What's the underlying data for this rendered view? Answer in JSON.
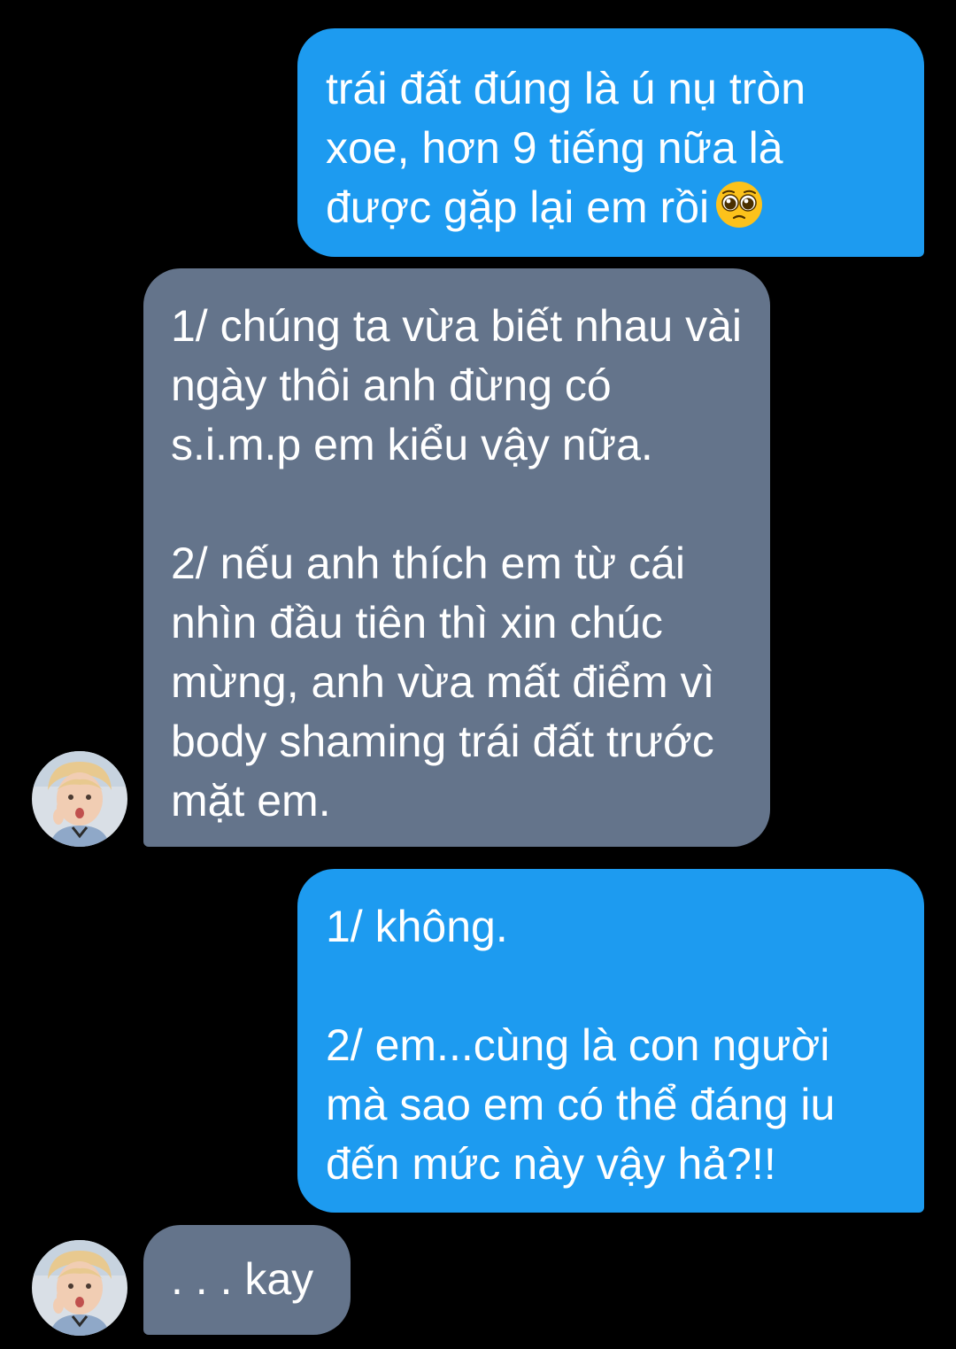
{
  "messages": [
    {
      "sender": "me",
      "text": "trái đất đúng là ú nụ tròn xoe, hơn 9 tiếng nữa là được gặp lại em rồi",
      "emoji": "pleading-face-icon"
    },
    {
      "sender": "them",
      "text": "1/ chúng ta vừa biết nhau vài ngày thôi anh đừng có s.i.m.p em kiểu vậy nữa.\n\n2/ nếu anh thích em từ cái nhìn đầu tiên thì xin chúc mừng, anh vừa mất điểm vì body shaming trái đất trước mặt em."
    },
    {
      "sender": "me",
      "text": "1/ không.\n\n2/ em...cùng là con người mà sao em có thể đáng iu đến mức này vậy hả?!!"
    },
    {
      "sender": "them",
      "text": ". . . kay"
    }
  ],
  "colors": {
    "background": "#000000",
    "outgoing_bubble": "#1d9bf0",
    "incoming_bubble": "#64748b",
    "text": "#ffffff"
  }
}
